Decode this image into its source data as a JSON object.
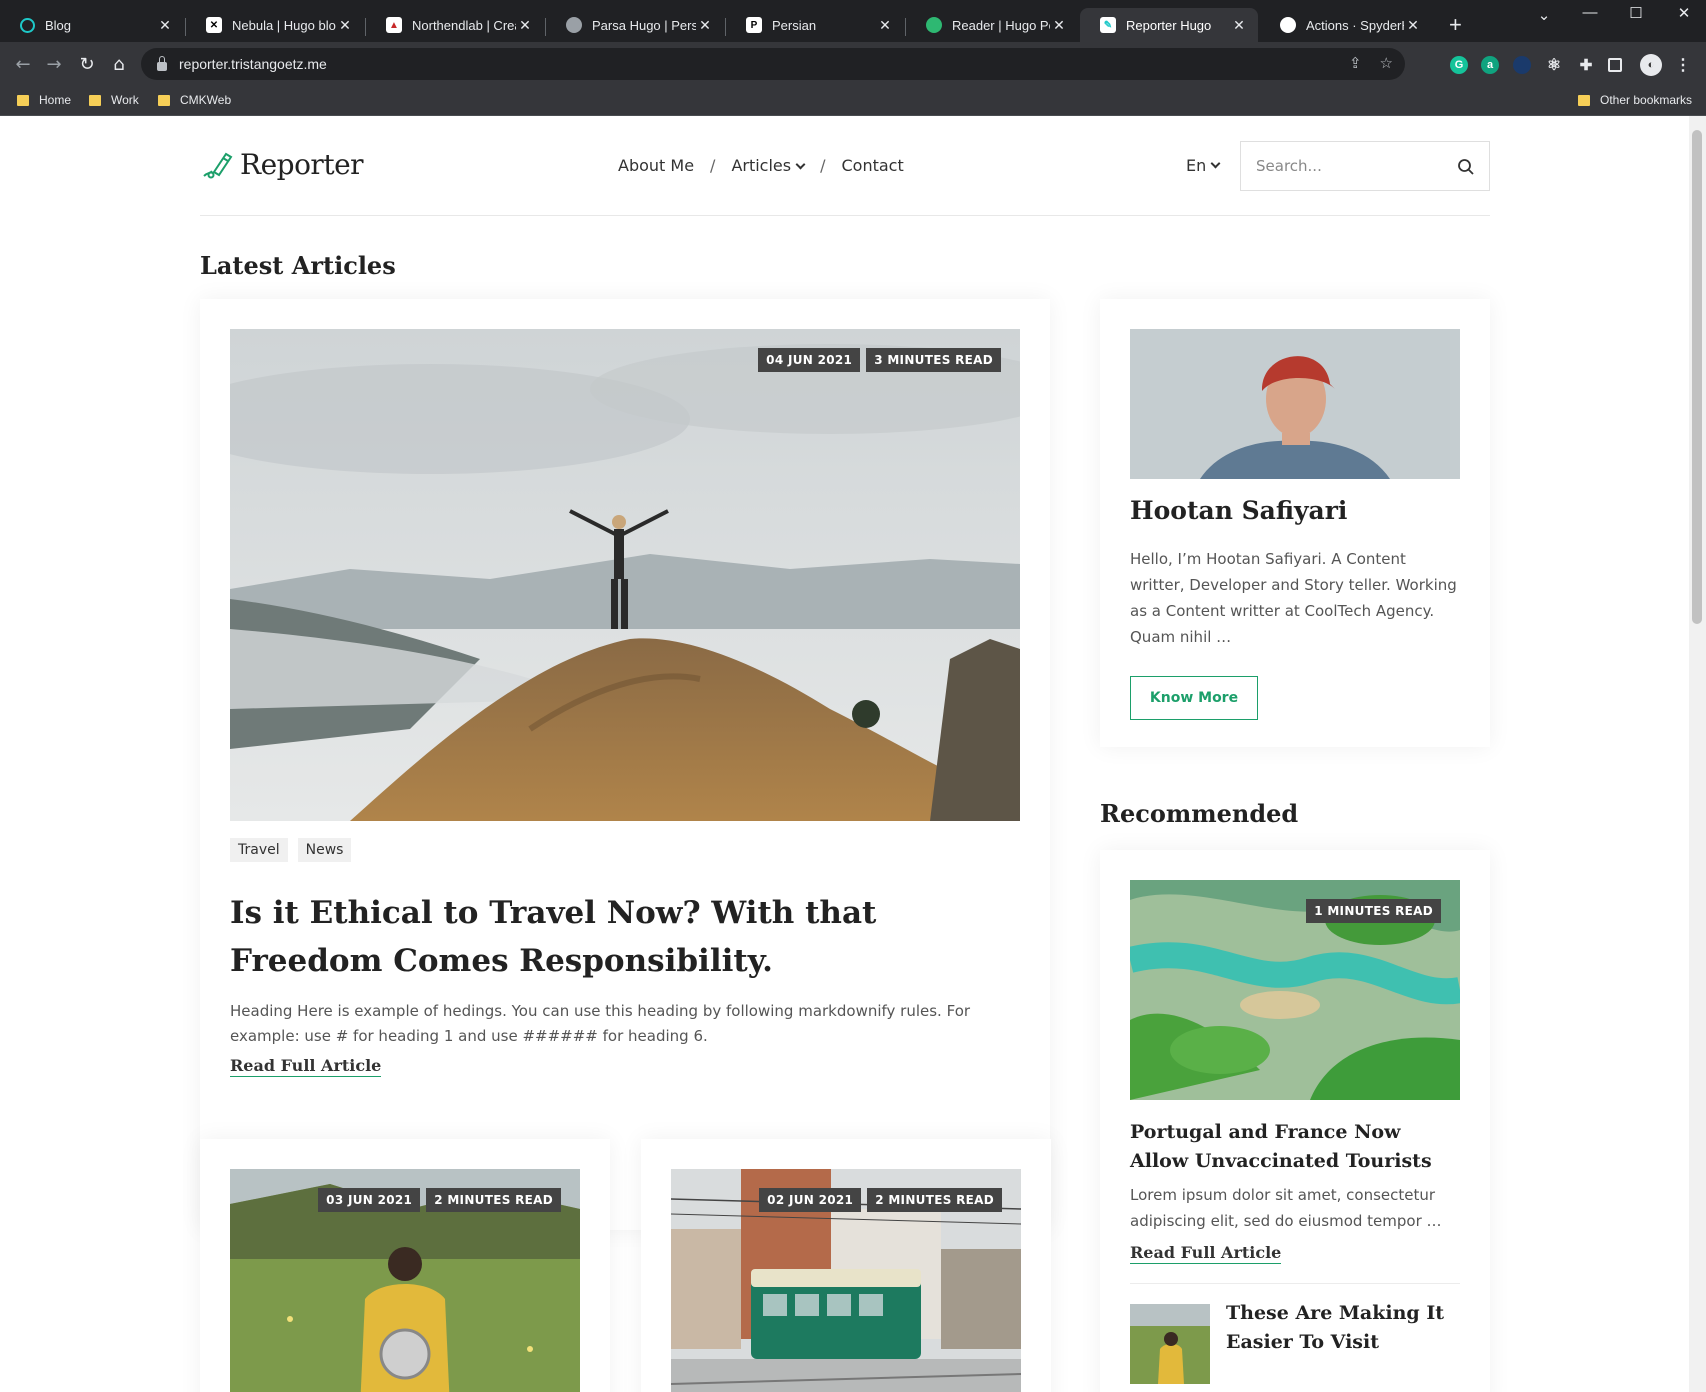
{
  "browser": {
    "tabs": [
      {
        "label": "Blog",
        "icon": "blog-tab-icon",
        "color": "#1ec8c8"
      },
      {
        "label": "Nebula | Hugo blog th",
        "icon": "nebula-tab-icon",
        "color": "#ffffff"
      },
      {
        "label": "Northendlab | Creativ",
        "icon": "northendlab-tab-icon",
        "color": "#c62828"
      },
      {
        "label": "Parsa Hugo | Persona",
        "icon": "parsa-tab-icon",
        "color": "#9aa0a6"
      },
      {
        "label": "Persian",
        "icon": "persian-tab-icon",
        "color": "#ffffff"
      },
      {
        "label": "Reader | Hugo Person",
        "icon": "reader-tab-icon",
        "color": "#2eb872"
      },
      {
        "label": "Reporter Hugo",
        "icon": "reporter-tab-icon",
        "color": "#1ec8c8"
      },
      {
        "label": "Actions · SpyderHunt",
        "icon": "github-tab-icon",
        "color": "#ffffff"
      }
    ],
    "url": "reporter.tristangoetz.me",
    "bookmarks": [
      {
        "label": "Home"
      },
      {
        "label": "Work"
      },
      {
        "label": "CMKWeb"
      }
    ],
    "other_bookmarks": "Other bookmarks"
  },
  "site": {
    "logo_text": "Reporter",
    "nav": {
      "about": "About Me",
      "articles": "Articles",
      "contact": "Contact",
      "separator": "/"
    },
    "lang": "En",
    "search_placeholder": "Search...",
    "accent": "#1c9f6a"
  },
  "latest": {
    "heading": "Latest Articles",
    "featured": {
      "date": "04 JUN 2021",
      "read_time": "3 MINUTES READ",
      "tags": [
        "Travel",
        "News"
      ],
      "title": "Is it Ethical to Travel Now? With that Freedom Comes Responsibility.",
      "excerpt": "Heading Here is example of hedings. You can use this heading by following markdownify rules. For example: use # for heading 1 and use ###### for heading 6.",
      "read_more": "Read Full Article"
    },
    "cards": [
      {
        "date": "03 JUN 2021",
        "read_time": "2 MINUTES READ"
      },
      {
        "date": "02 JUN 2021",
        "read_time": "2 MINUTES READ"
      }
    ]
  },
  "author": {
    "name": "Hootan Safiyari",
    "bio": "Hello, I’m Hootan Safiyari. A Content writter, Developer and Story teller. Working as a Content writter at CoolTech Agency. Quam nihil …",
    "button": "Know More"
  },
  "recommended": {
    "heading": "Recommended",
    "main": {
      "read_time": "1 MINUTES READ",
      "title": "Portugal and France Now Allow Unvaccinated Tourists",
      "excerpt": "Lorem ipsum dolor sit amet, consectetur adipiscing elit, sed do eiusmod tempor …",
      "read_more": "Read Full Article"
    },
    "second": {
      "title": "These Are Making It Easier To Visit"
    }
  }
}
